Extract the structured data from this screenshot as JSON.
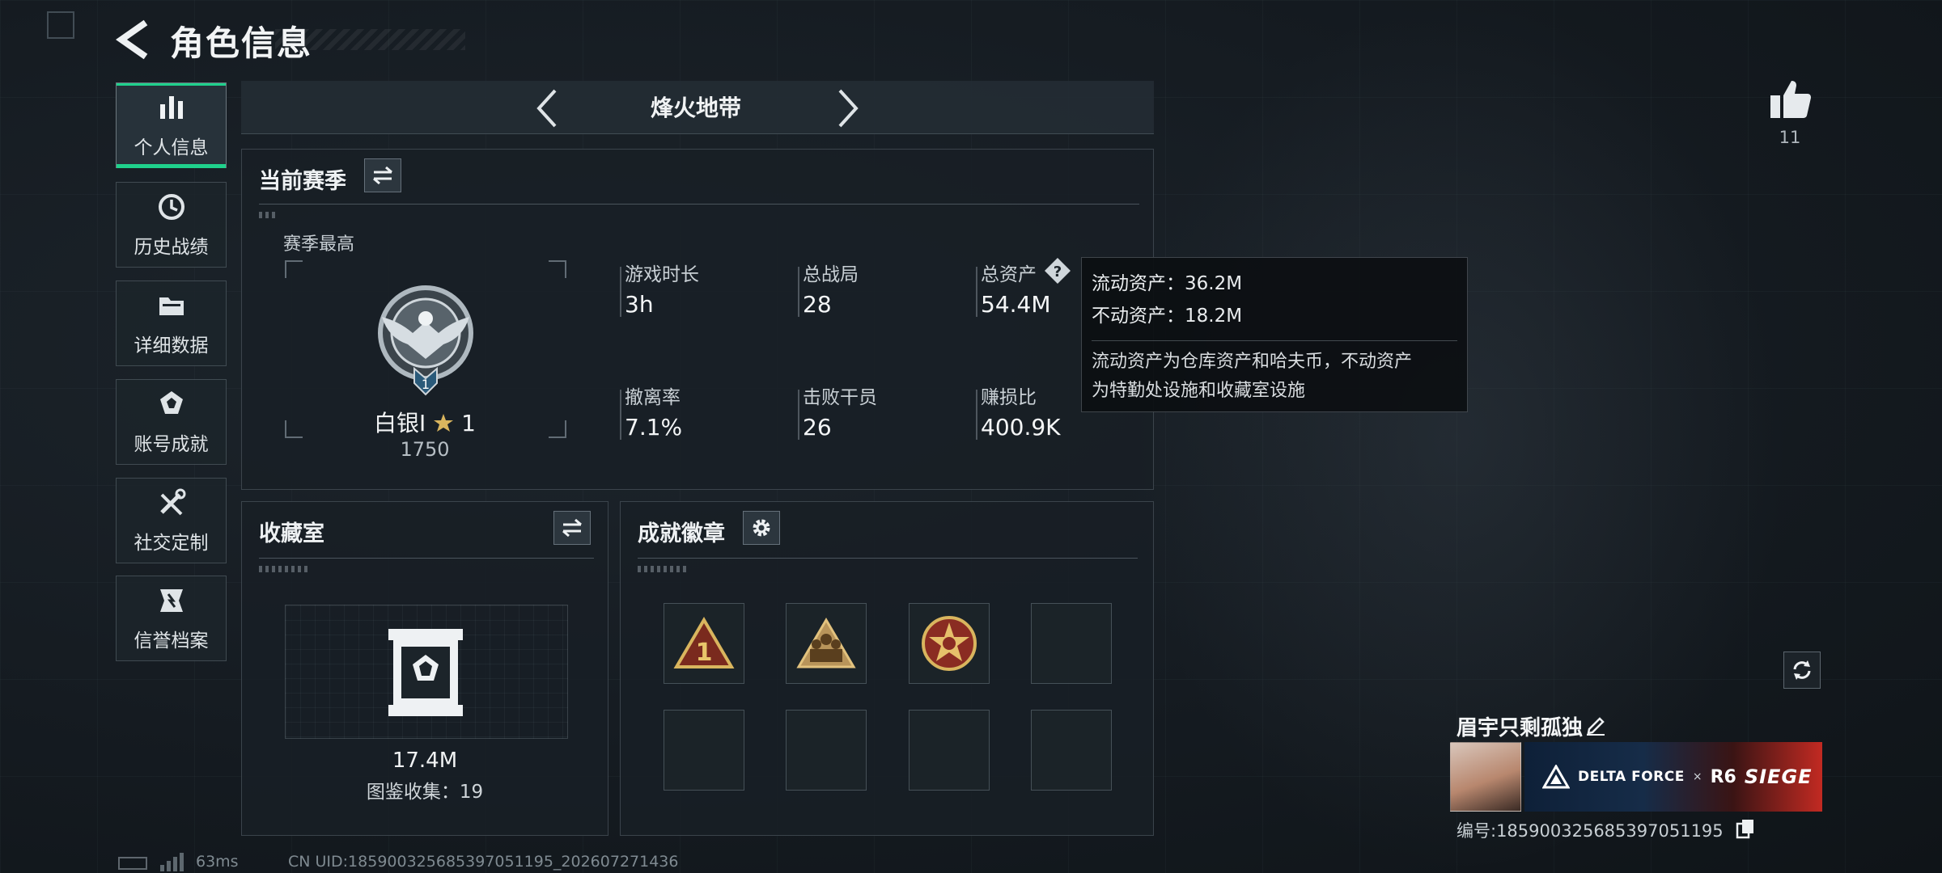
{
  "header": {
    "title": "角色信息"
  },
  "sidebar": {
    "items": [
      {
        "label": "个人信息",
        "icon": "bar-chart-icon"
      },
      {
        "label": "历史战绩",
        "icon": "history-clock-icon"
      },
      {
        "label": "详细数据",
        "icon": "folder-icon"
      },
      {
        "label": "账号成就",
        "icon": "achievement-icon"
      },
      {
        "label": "社交定制",
        "icon": "tools-icon"
      },
      {
        "label": "信誉档案",
        "icon": "reputation-icon"
      }
    ]
  },
  "mode": {
    "title": "烽火地带"
  },
  "season": {
    "title": "当前赛季",
    "best_label": "赛季最高",
    "rank_name": "白银I",
    "rank_stars": "1",
    "rank_score": "1750",
    "rank_emblem_number": "1",
    "stats": [
      {
        "label": "游戏时长",
        "value": "3h"
      },
      {
        "label": "总战局",
        "value": "28"
      },
      {
        "label": "总资产",
        "value": "54.4M"
      },
      {
        "label": "撤离率",
        "value": "7.1%"
      },
      {
        "label": "击败干员",
        "value": "26"
      },
      {
        "label": "赚损比",
        "value": "400.9K"
      }
    ]
  },
  "tooltip": {
    "line1": "流动资产：36.2M",
    "line2": "不动资产：18.2M",
    "desc1": "流动资产为仓库资产和哈夫币，不动资产",
    "desc2": "为特勤处设施和收藏室设施"
  },
  "collection": {
    "title": "收藏室",
    "value": "17.4M",
    "count": "图鉴收集：19"
  },
  "badges": {
    "title": "成就徽章",
    "slots": [
      "rank-one-badge",
      "squad-badge",
      "star-medal-badge",
      "",
      "",
      "",
      "",
      ""
    ]
  },
  "profile": {
    "likes": "11",
    "name": "眉宇只剩孤独",
    "banner_brand": "DELTA FORCE",
    "banner_x": "×",
    "banner_r6": "R6",
    "banner_siege": "SIEGE",
    "id": "编号:185900325685397051195"
  },
  "footer": {
    "ping": "63ms",
    "uid": "CN UID:185900325685397051195_202607271436"
  },
  "colors": {
    "accent": "#1fd18c",
    "tooltip_bg": "#0c0f12"
  }
}
